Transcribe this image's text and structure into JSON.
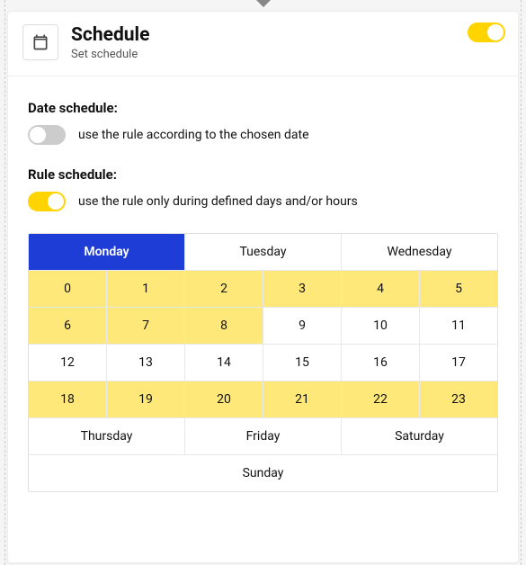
{
  "header": {
    "title": "Schedule",
    "subtitle": "Set schedule",
    "enabled": true
  },
  "date_schedule": {
    "label": "Date schedule:",
    "description": "use the rule according to the chosen date",
    "enabled": false
  },
  "rule_schedule": {
    "label": "Rule schedule:",
    "description": "use the rule only during defined days and/or hours",
    "enabled": true
  },
  "schedule_grid": {
    "days_top": [
      {
        "label": "Monday",
        "active": true
      },
      {
        "label": "Tuesday",
        "active": false
      },
      {
        "label": "Wednesday",
        "active": false
      }
    ],
    "hours": [
      [
        {
          "value": "0",
          "highlighted": true
        },
        {
          "value": "1",
          "highlighted": true
        },
        {
          "value": "2",
          "highlighted": true
        },
        {
          "value": "3",
          "highlighted": true
        },
        {
          "value": "4",
          "highlighted": true
        },
        {
          "value": "5",
          "highlighted": true
        }
      ],
      [
        {
          "value": "6",
          "highlighted": true
        },
        {
          "value": "7",
          "highlighted": true
        },
        {
          "value": "8",
          "highlighted": true
        },
        {
          "value": "9",
          "highlighted": false
        },
        {
          "value": "10",
          "highlighted": false
        },
        {
          "value": "11",
          "highlighted": false
        }
      ],
      [
        {
          "value": "12",
          "highlighted": false
        },
        {
          "value": "13",
          "highlighted": false
        },
        {
          "value": "14",
          "highlighted": false
        },
        {
          "value": "15",
          "highlighted": false
        },
        {
          "value": "16",
          "highlighted": false
        },
        {
          "value": "17",
          "highlighted": false
        }
      ],
      [
        {
          "value": "18",
          "highlighted": true
        },
        {
          "value": "19",
          "highlighted": true
        },
        {
          "value": "20",
          "highlighted": true
        },
        {
          "value": "21",
          "highlighted": true
        },
        {
          "value": "22",
          "highlighted": true
        },
        {
          "value": "23",
          "highlighted": true
        }
      ]
    ],
    "days_mid": [
      {
        "label": "Thursday"
      },
      {
        "label": "Friday"
      },
      {
        "label": "Saturday"
      }
    ],
    "days_bottom": [
      {
        "label": "Sunday"
      }
    ]
  }
}
